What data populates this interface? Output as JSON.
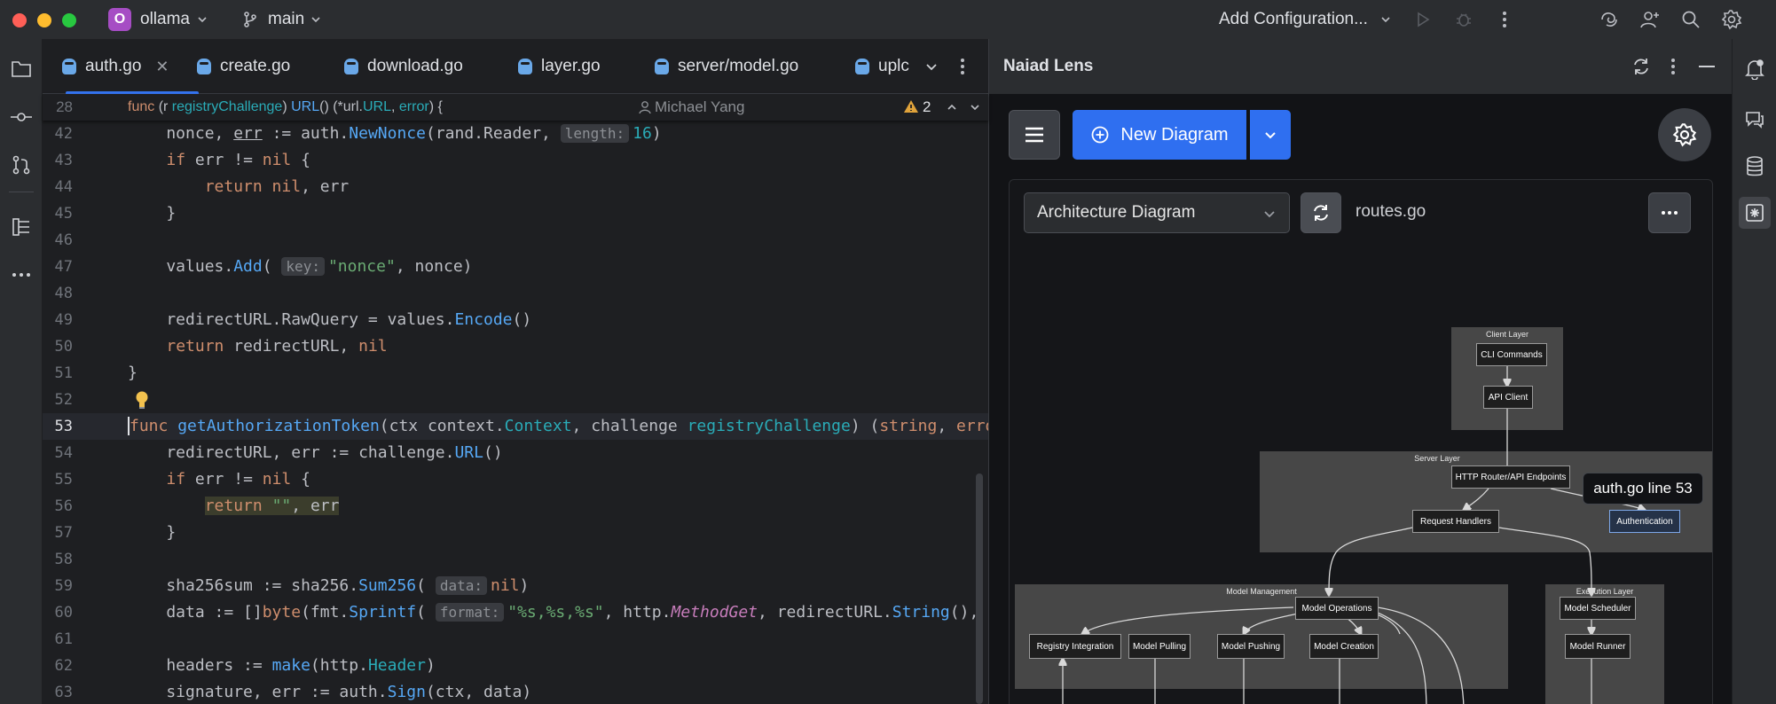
{
  "titlebar": {
    "project_initial": "O",
    "project_name": "ollama",
    "branch": "main",
    "run_config": "Add Configuration..."
  },
  "tabs": [
    {
      "label": "auth.go",
      "active": true
    },
    {
      "label": "create.go"
    },
    {
      "label": "download.go"
    },
    {
      "label": "layer.go"
    },
    {
      "label": "server/model.go"
    },
    {
      "label": "uplc"
    }
  ],
  "editor": {
    "sticky": {
      "num": "28",
      "author": "Michael Yang",
      "warnings": "2"
    },
    "hints": {
      "length": "length:",
      "key": "key:",
      "data": "data:",
      "format": "format:"
    },
    "lines": [
      "42",
      "43",
      "44",
      "45",
      "46",
      "47",
      "48",
      "49",
      "50",
      "51",
      "52",
      "53",
      "54",
      "55",
      "56",
      "57",
      "58",
      "59",
      "60",
      "61",
      "62",
      "63"
    ]
  },
  "panel": {
    "title": "Naiad Lens",
    "new_diagram": "New Diagram",
    "diagram_type": "Architecture Diagram",
    "file": "routes.go",
    "tooltip": "auth.go line 53"
  },
  "diagram": {
    "groups": {
      "client": "Client Layer",
      "server": "Server Layer",
      "model_mgmt": "Model Management",
      "execution": "Execution Layer"
    },
    "nodes": {
      "cli": "CLI Commands",
      "api_client": "API Client",
      "router": "HTTP Router/API Endpoints",
      "handlers": "Request Handlers",
      "auth": "Authentication",
      "model_ops": "Model Operations",
      "registry": "Registry Integration",
      "pulling": "Model Pulling",
      "pushing": "Model Pushing",
      "creation": "Model Creation",
      "scheduler": "Model Scheduler",
      "runner": "Model Runner"
    }
  },
  "colors": {
    "accent": "#2f6ff0",
    "keyword": "#cf8e6d",
    "function": "#56a8f5",
    "string": "#6aab73"
  }
}
